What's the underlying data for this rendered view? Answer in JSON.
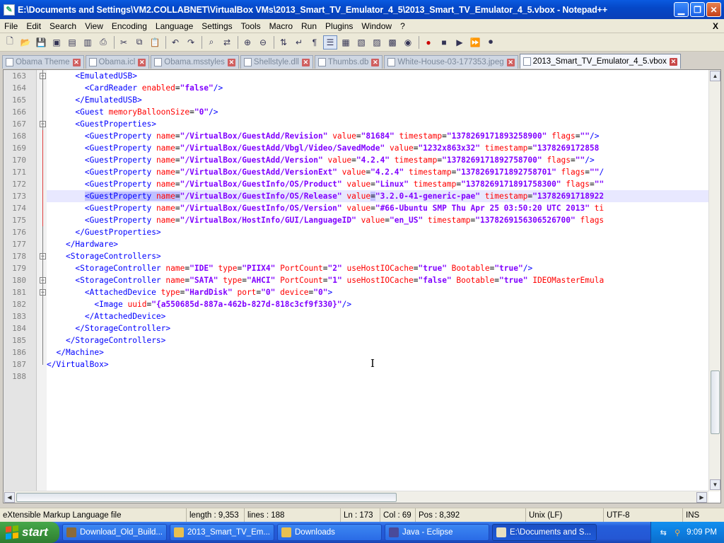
{
  "window": {
    "title": "E:\\Documents and Settings\\VM2.COLLABNET\\VirtualBox VMs\\2013_Smart_TV_Emulator_4_5\\2013_Smart_TV_Emulator_4_5.vbox - Notepad++"
  },
  "menu": [
    "File",
    "Edit",
    "Search",
    "View",
    "Encoding",
    "Language",
    "Settings",
    "Tools",
    "Macro",
    "Run",
    "Plugins",
    "Window",
    "?"
  ],
  "menu_close": "X",
  "tabs": [
    {
      "label": "Obama Theme",
      "active": false
    },
    {
      "label": "Obama.icl",
      "active": false
    },
    {
      "label": "Obama.msstyles",
      "active": false
    },
    {
      "label": "Shellstyle.dll",
      "active": false
    },
    {
      "label": "Thumbs.db",
      "active": false
    },
    {
      "label": "White-House-03-177353.jpeg",
      "active": false
    },
    {
      "label": "2013_Smart_TV_Emulator_4_5.vbox",
      "active": true
    }
  ],
  "editor": {
    "current_line": 173,
    "lines": [
      {
        "n": "163",
        "indent": 6,
        "parts": [
          [
            "tg",
            "<EmulatedUSB>"
          ]
        ]
      },
      {
        "n": "164",
        "indent": 8,
        "parts": [
          [
            "tg",
            "<CardReader "
          ],
          [
            "at",
            "enabled"
          ],
          [
            "eq",
            "="
          ],
          [
            "vl",
            "\"false\""
          ],
          [
            "tg",
            "/>"
          ]
        ]
      },
      {
        "n": "165",
        "indent": 6,
        "parts": [
          [
            "tg",
            "</EmulatedUSB>"
          ]
        ]
      },
      {
        "n": "166",
        "indent": 6,
        "parts": [
          [
            "tg",
            "<Guest "
          ],
          [
            "at",
            "memoryBalloonSize"
          ],
          [
            "eq",
            "="
          ],
          [
            "vl",
            "\"0\""
          ],
          [
            "tg",
            "/>"
          ]
        ]
      },
      {
        "n": "167",
        "indent": 6,
        "parts": [
          [
            "tg",
            "<GuestProperties>"
          ]
        ]
      },
      {
        "n": "168",
        "indent": 8,
        "parts": [
          [
            "tg",
            "<GuestProperty "
          ],
          [
            "at",
            "name"
          ],
          [
            "eq",
            "="
          ],
          [
            "vl",
            "\"/VirtualBox/GuestAdd/Revision\""
          ],
          [
            "at",
            " value"
          ],
          [
            "eq",
            "="
          ],
          [
            "vl",
            "\"81684\""
          ],
          [
            "at",
            " timestamp"
          ],
          [
            "eq",
            "="
          ],
          [
            "vl",
            "\"1378269171893258900\""
          ],
          [
            "at",
            " flags"
          ],
          [
            "eq",
            "="
          ],
          [
            "vl",
            "\"\""
          ],
          [
            "tg",
            "/>"
          ]
        ]
      },
      {
        "n": "169",
        "indent": 8,
        "parts": [
          [
            "tg",
            "<GuestProperty "
          ],
          [
            "at",
            "name"
          ],
          [
            "eq",
            "="
          ],
          [
            "vl",
            "\"/VirtualBox/GuestAdd/Vbgl/Video/SavedMode\""
          ],
          [
            "at",
            " value"
          ],
          [
            "eq",
            "="
          ],
          [
            "vl",
            "\"1232x863x32\""
          ],
          [
            "at",
            " timestamp"
          ],
          [
            "eq",
            "="
          ],
          [
            "vl",
            "\"1378269172858"
          ]
        ]
      },
      {
        "n": "170",
        "indent": 8,
        "parts": [
          [
            "tg",
            "<GuestProperty "
          ],
          [
            "at",
            "name"
          ],
          [
            "eq",
            "="
          ],
          [
            "vl",
            "\"/VirtualBox/GuestAdd/Version\""
          ],
          [
            "at",
            " value"
          ],
          [
            "eq",
            "="
          ],
          [
            "vl",
            "\"4.2.4\""
          ],
          [
            "at",
            " timestamp"
          ],
          [
            "eq",
            "="
          ],
          [
            "vl",
            "\"1378269171892758700\""
          ],
          [
            "at",
            " flags"
          ],
          [
            "eq",
            "="
          ],
          [
            "vl",
            "\"\""
          ],
          [
            "tg",
            "/>"
          ]
        ]
      },
      {
        "n": "171",
        "indent": 8,
        "parts": [
          [
            "tg",
            "<GuestProperty "
          ],
          [
            "at",
            "name"
          ],
          [
            "eq",
            "="
          ],
          [
            "vl",
            "\"/VirtualBox/GuestAdd/VersionExt\""
          ],
          [
            "at",
            " value"
          ],
          [
            "eq",
            "="
          ],
          [
            "vl",
            "\"4.2.4\""
          ],
          [
            "at",
            " timestamp"
          ],
          [
            "eq",
            "="
          ],
          [
            "vl",
            "\"1378269171892758701\""
          ],
          [
            "at",
            " flags"
          ],
          [
            "eq",
            "="
          ],
          [
            "vl",
            "\"\""
          ],
          [
            "tg",
            "/"
          ]
        ]
      },
      {
        "n": "172",
        "indent": 8,
        "parts": [
          [
            "tg",
            "<GuestProperty "
          ],
          [
            "at",
            "name"
          ],
          [
            "eq",
            "="
          ],
          [
            "vl",
            "\"/VirtualBox/GuestInfo/OS/Product\""
          ],
          [
            "at",
            " value"
          ],
          [
            "eq",
            "="
          ],
          [
            "vl",
            "\"Linux\""
          ],
          [
            "at",
            " timestamp"
          ],
          [
            "eq",
            "="
          ],
          [
            "vl",
            "\"1378269171891758300\""
          ],
          [
            "at",
            " flags"
          ],
          [
            "eq",
            "="
          ],
          [
            "vl",
            "\"\""
          ]
        ]
      },
      {
        "n": "173",
        "indent": 8,
        "parts": [
          [
            "tg",
            "<GuestProperty"
          ],
          [
            "tg",
            " "
          ],
          [
            "at",
            "name"
          ],
          [
            "eq",
            "="
          ],
          [
            "vl",
            "\"/VirtualBox/GuestInfo/OS/Release\""
          ],
          [
            "at",
            " value"
          ],
          [
            "eq",
            "="
          ],
          [
            "vl",
            "\"3.2.0-41-generic-pae\""
          ],
          [
            "at",
            " timestamp"
          ],
          [
            "eq",
            "="
          ],
          [
            "vl",
            "\"13782691718922"
          ]
        ]
      },
      {
        "n": "174",
        "indent": 8,
        "parts": [
          [
            "tg",
            "<GuestProperty "
          ],
          [
            "at",
            "name"
          ],
          [
            "eq",
            "="
          ],
          [
            "vl",
            "\"/VirtualBox/GuestInfo/OS/Version\""
          ],
          [
            "at",
            " value"
          ],
          [
            "eq",
            "="
          ],
          [
            "vl",
            "\"#66-Ubuntu SMP Thu Apr 25 03:50:20 UTC 2013\""
          ],
          [
            "at",
            " ti"
          ]
        ]
      },
      {
        "n": "175",
        "indent": 8,
        "parts": [
          [
            "tg",
            "<GuestProperty "
          ],
          [
            "at",
            "name"
          ],
          [
            "eq",
            "="
          ],
          [
            "vl",
            "\"/VirtualBox/HostInfo/GUI/LanguageID\""
          ],
          [
            "at",
            " value"
          ],
          [
            "eq",
            "="
          ],
          [
            "vl",
            "\"en_US\""
          ],
          [
            "at",
            " timestamp"
          ],
          [
            "eq",
            "="
          ],
          [
            "vl",
            "\"1378269156306526700\""
          ],
          [
            "at",
            " flags"
          ]
        ]
      },
      {
        "n": "176",
        "indent": 6,
        "parts": [
          [
            "tg",
            "</GuestProperties>"
          ]
        ]
      },
      {
        "n": "177",
        "indent": 4,
        "parts": [
          [
            "tg",
            "</Hardware>"
          ]
        ]
      },
      {
        "n": "178",
        "indent": 4,
        "parts": [
          [
            "tg",
            "<StorageControllers>"
          ]
        ]
      },
      {
        "n": "179",
        "indent": 6,
        "parts": [
          [
            "tg",
            "<StorageController "
          ],
          [
            "at",
            "name"
          ],
          [
            "eq",
            "="
          ],
          [
            "vl",
            "\"IDE\""
          ],
          [
            "at",
            " type"
          ],
          [
            "eq",
            "="
          ],
          [
            "vl",
            "\"PIIX4\""
          ],
          [
            "at",
            " PortCount"
          ],
          [
            "eq",
            "="
          ],
          [
            "vl",
            "\"2\""
          ],
          [
            "at",
            " useHostIOCache"
          ],
          [
            "eq",
            "="
          ],
          [
            "vl",
            "\"true\""
          ],
          [
            "at",
            " Bootable"
          ],
          [
            "eq",
            "="
          ],
          [
            "vl",
            "\"true\""
          ],
          [
            "tg",
            "/>"
          ]
        ]
      },
      {
        "n": "180",
        "indent": 6,
        "parts": [
          [
            "tg",
            "<StorageController "
          ],
          [
            "at",
            "name"
          ],
          [
            "eq",
            "="
          ],
          [
            "vl",
            "\"SATA\""
          ],
          [
            "at",
            " type"
          ],
          [
            "eq",
            "="
          ],
          [
            "vl",
            "\"AHCI\""
          ],
          [
            "at",
            " PortCount"
          ],
          [
            "eq",
            "="
          ],
          [
            "vl",
            "\"1\""
          ],
          [
            "at",
            " useHostIOCache"
          ],
          [
            "eq",
            "="
          ],
          [
            "vl",
            "\"false\""
          ],
          [
            "at",
            " Bootable"
          ],
          [
            "eq",
            "="
          ],
          [
            "vl",
            "\"true\""
          ],
          [
            "at",
            " IDEOMasterEmula"
          ]
        ]
      },
      {
        "n": "181",
        "indent": 8,
        "parts": [
          [
            "tg",
            "<AttachedDevice "
          ],
          [
            "at",
            "type"
          ],
          [
            "eq",
            "="
          ],
          [
            "vl",
            "\"HardDisk\""
          ],
          [
            "at",
            " port"
          ],
          [
            "eq",
            "="
          ],
          [
            "vl",
            "\"0\""
          ],
          [
            "at",
            " device"
          ],
          [
            "eq",
            "="
          ],
          [
            "vl",
            "\"0\""
          ],
          [
            "tg",
            ">"
          ]
        ]
      },
      {
        "n": "182",
        "indent": 10,
        "parts": [
          [
            "tg",
            "<Image "
          ],
          [
            "at",
            "uuid"
          ],
          [
            "eq",
            "="
          ],
          [
            "vl",
            "\"{a550685d-887a-462b-827d-818c3cf9f330}\""
          ],
          [
            "tg",
            "/>"
          ]
        ]
      },
      {
        "n": "183",
        "indent": 8,
        "parts": [
          [
            "tg",
            "</AttachedDevice>"
          ]
        ]
      },
      {
        "n": "184",
        "indent": 6,
        "parts": [
          [
            "tg",
            "</StorageController>"
          ]
        ]
      },
      {
        "n": "185",
        "indent": 4,
        "parts": [
          [
            "tg",
            "</StorageControllers>"
          ]
        ]
      },
      {
        "n": "186",
        "indent": 2,
        "parts": [
          [
            "tg",
            "</Machine>"
          ]
        ]
      },
      {
        "n": "187",
        "indent": 0,
        "parts": [
          [
            "tg",
            "</VirtualBox>"
          ]
        ]
      },
      {
        "n": "188",
        "indent": 0,
        "parts": []
      }
    ]
  },
  "status": {
    "filetype": "eXtensible Markup Language file",
    "length": "length : 9,353",
    "lines": "lines : 188",
    "ln": "Ln : 173",
    "col": "Col : 69",
    "pos": "Pos : 8,392",
    "eol": "Unix (LF)",
    "encoding": "UTF-8",
    "mode": "INS"
  },
  "taskbar": {
    "start": "start",
    "tasks": [
      {
        "label": "Download_Old_Build...",
        "icon_color": "#8a6a3a",
        "active": false
      },
      {
        "label": "2013_Smart_TV_Em...",
        "icon_color": "#e8c050",
        "active": false
      },
      {
        "label": "Downloads",
        "icon_color": "#e8c050",
        "active": false
      },
      {
        "label": "Java - Eclipse",
        "icon_color": "#4a4a9a",
        "active": false
      },
      {
        "label": "E:\\Documents and S...",
        "icon_color": "#e8e0c0",
        "active": true
      }
    ],
    "clock": "9:09 PM"
  },
  "colors": {
    "tag": "#0000ff",
    "attr": "#ff0000",
    "value": "#8000ff",
    "current_line": "#e8e8ff"
  }
}
